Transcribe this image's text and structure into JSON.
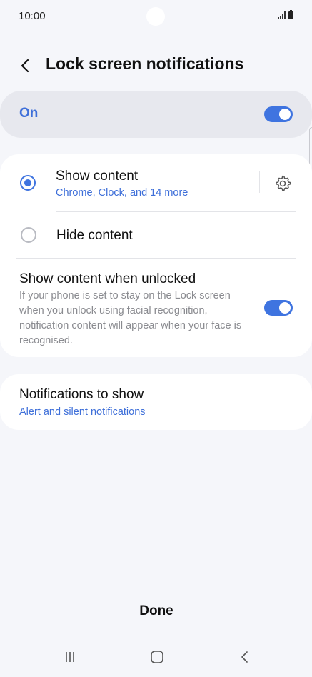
{
  "status_bar": {
    "time": "10:00"
  },
  "header": {
    "title": "Lock screen notifications"
  },
  "master": {
    "label": "On",
    "enabled": true
  },
  "options": {
    "show_content": {
      "label": "Show content",
      "sub": "Chrome, Clock, and 14 more",
      "selected": true
    },
    "hide_content": {
      "label": "Hide content",
      "selected": false
    }
  },
  "unlocked": {
    "title": "Show content when unlocked",
    "description": "If your phone is set to stay on the Lock screen when you unlock using facial recognition, notification content will appear when your face is recognised.",
    "enabled": true
  },
  "notifications": {
    "title": "Notifications to show",
    "sub": "Alert and silent notifications"
  },
  "footer": {
    "done_label": "Done"
  },
  "colors": {
    "accent": "#3f74e0",
    "background": "#f5f6fa",
    "card": "#ffffff",
    "master_bg": "#e7e8ee"
  }
}
